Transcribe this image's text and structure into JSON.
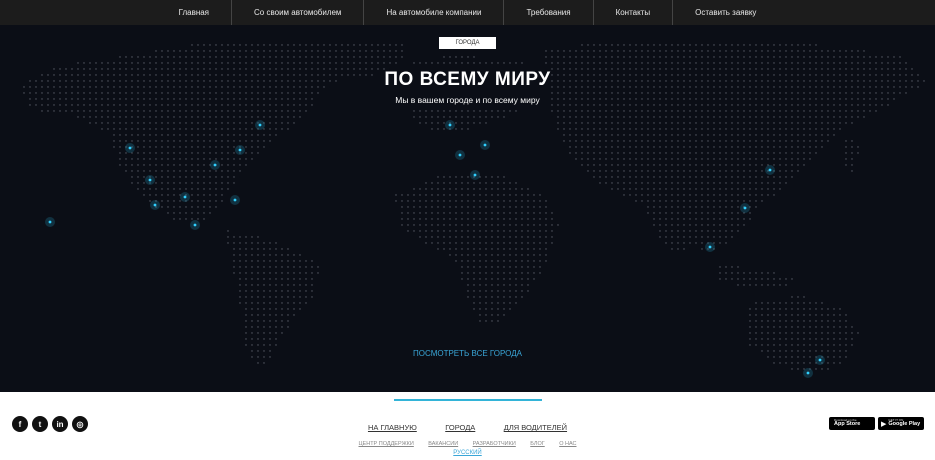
{
  "nav": {
    "items": [
      "Главная",
      "Со своим автомобилем",
      "На автомобиле компании",
      "Требования",
      "Контакты",
      "Оставить заявку"
    ]
  },
  "hero": {
    "badge": "ГОРОДА",
    "title": "ПО ВСЕМУ МИРУ",
    "subtitle": "Мы в вашем городе и по всему миру",
    "cities_link": "ПОСМОТРЕТЬ ВСЕ ГОРОДА",
    "colors": {
      "background": "#0b0e16",
      "dots": "#9aa0ae",
      "highlight": "#2fd0ff"
    }
  },
  "footer": {
    "social": [
      {
        "icon": "facebook-icon",
        "glyph": "f"
      },
      {
        "icon": "twitter-icon",
        "glyph": "t"
      },
      {
        "icon": "linkedin-icon",
        "glyph": "in"
      },
      {
        "icon": "instagram-icon",
        "glyph": "◎"
      }
    ],
    "main_links": [
      "НА ГЛАВНУЮ",
      "ГОРОДА",
      "ДЛЯ ВОДИТЕЛЕЙ"
    ],
    "sub_links": [
      "ЦЕНТР ПОДДЕРЖКИ",
      "ВАКАНСИИ",
      "РАЗРАБОТЧИКИ",
      "БЛОГ",
      "О НАС"
    ],
    "language": "РУССКИЙ",
    "stores": [
      {
        "icon": "apple-icon",
        "small": "Download on the",
        "big": "App Store"
      },
      {
        "icon": "google-play-icon",
        "small": "GET IT ON",
        "big": "Google Play"
      }
    ],
    "accent": "#33b4d8"
  }
}
